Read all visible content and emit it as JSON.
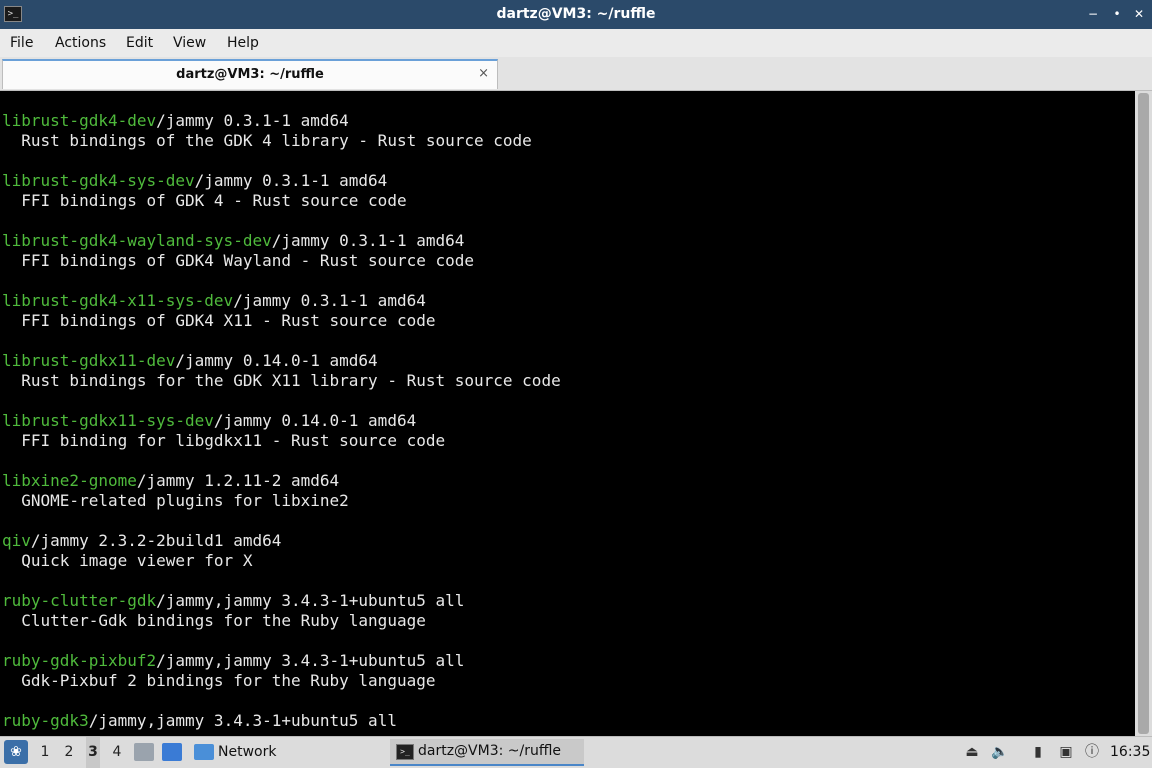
{
  "window": {
    "title": "dartz@VM3: ~/ruffle"
  },
  "menu": [
    "File",
    "Actions",
    "Edit",
    "View",
    "Help"
  ],
  "tab": {
    "label": "dartz@VM3: ~/ruffle",
    "close": "×"
  },
  "terminal": {
    "lines": [
      {
        "pkg": "",
        "rest": ""
      },
      {
        "pkg": "librust-gdk4-dev",
        "rest": "/jammy 0.3.1-1 amd64"
      },
      {
        "pkg": "",
        "rest": "  Rust bindings of the GDK 4 library - Rust source code"
      },
      {
        "pkg": "",
        "rest": ""
      },
      {
        "pkg": "librust-gdk4-sys-dev",
        "rest": "/jammy 0.3.1-1 amd64"
      },
      {
        "pkg": "",
        "rest": "  FFI bindings of GDK 4 - Rust source code"
      },
      {
        "pkg": "",
        "rest": ""
      },
      {
        "pkg": "librust-gdk4-wayland-sys-dev",
        "rest": "/jammy 0.3.1-1 amd64"
      },
      {
        "pkg": "",
        "rest": "  FFI bindings of GDK4 Wayland - Rust source code"
      },
      {
        "pkg": "",
        "rest": ""
      },
      {
        "pkg": "librust-gdk4-x11-sys-dev",
        "rest": "/jammy 0.3.1-1 amd64"
      },
      {
        "pkg": "",
        "rest": "  FFI bindings of GDK4 X11 - Rust source code"
      },
      {
        "pkg": "",
        "rest": ""
      },
      {
        "pkg": "librust-gdkx11-dev",
        "rest": "/jammy 0.14.0-1 amd64"
      },
      {
        "pkg": "",
        "rest": "  Rust bindings for the GDK X11 library - Rust source code"
      },
      {
        "pkg": "",
        "rest": ""
      },
      {
        "pkg": "librust-gdkx11-sys-dev",
        "rest": "/jammy 0.14.0-1 amd64"
      },
      {
        "pkg": "",
        "rest": "  FFI binding for libgdkx11 - Rust source code"
      },
      {
        "pkg": "",
        "rest": ""
      },
      {
        "pkg": "libxine2-gnome",
        "rest": "/jammy 1.2.11-2 amd64"
      },
      {
        "pkg": "",
        "rest": "  GNOME-related plugins for libxine2"
      },
      {
        "pkg": "",
        "rest": ""
      },
      {
        "pkg": "qiv",
        "rest": "/jammy 2.3.2-2build1 amd64"
      },
      {
        "pkg": "",
        "rest": "  Quick image viewer for X"
      },
      {
        "pkg": "",
        "rest": ""
      },
      {
        "pkg": "ruby-clutter-gdk",
        "rest": "/jammy,jammy 3.4.3-1+ubuntu5 all"
      },
      {
        "pkg": "",
        "rest": "  Clutter-Gdk bindings for the Ruby language"
      },
      {
        "pkg": "",
        "rest": ""
      },
      {
        "pkg": "ruby-gdk-pixbuf2",
        "rest": "/jammy,jammy 3.4.3-1+ubuntu5 all"
      },
      {
        "pkg": "",
        "rest": "  Gdk-Pixbuf 2 bindings for the Ruby language"
      },
      {
        "pkg": "",
        "rest": ""
      },
      {
        "pkg": "ruby-gdk3",
        "rest": "/jammy,jammy 3.4.3-1+ubuntu5 all"
      }
    ]
  },
  "taskbar": {
    "workspaces": [
      "1",
      "2",
      "3",
      "4"
    ],
    "active_workspace": "3",
    "network_label": "Network",
    "task_label": "dartz@VM3: ~/ruffle",
    "clock": "16:35"
  },
  "icons": {
    "app": "terminal-icon",
    "start": "start-menu-icon",
    "volume": "volume-icon"
  }
}
